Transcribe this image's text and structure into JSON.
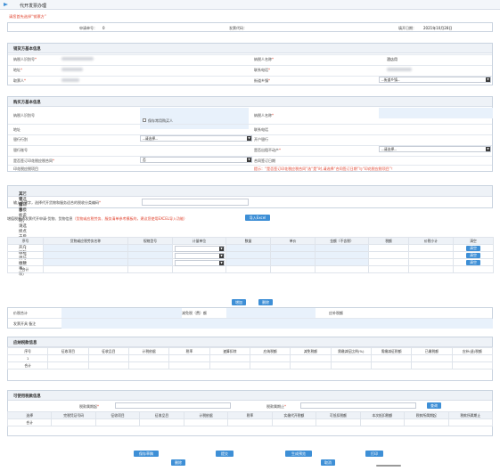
{
  "page": {
    "title": "代开发票办理",
    "hint": "请您首先选择“销票方”"
  },
  "top": {
    "apply_no_label": "申请单号：",
    "apply_no_value": "0",
    "invoice_code_label": "发票代码：",
    "fill_date_label": "填开日期：",
    "fill_date_value": "2021年10月28日"
  },
  "seller": {
    "section": "销货方基本信息",
    "taxid_label": "纳税人识别号",
    "name_label": "纳税人名称",
    "name_value": "酒店用",
    "address_label": "地址",
    "phone_label": "联系电话",
    "ticket_party_label": "取票人",
    "township_label": "街道乡镇",
    "township_value": "--街道乡镇--"
  },
  "buyer": {
    "section": "购买方基本信息",
    "taxid_label": "纳税人识别号",
    "name_label": "纳税人名称",
    "save_common_label": "保存常用购买人",
    "address_label": "地址",
    "phone_label": "联系电话",
    "bank_label": "银行行别",
    "bank_value": "--请选择--",
    "branch_label": "开户银行",
    "account_label": "银行账号",
    "flag_label": "是否出租不动产",
    "flag_value": "--请选择--",
    "sign_label": "是否签订印花税应税合同",
    "sign_value": "否",
    "contract_date_label": "合同签订日期",
    "stamp_item_label": "印花税应税项目",
    "stamp_hint": "提示：“是否签订印花税应税合同”选“是”时,请选择“合同签订日期”与“印花税应税项目”！"
  },
  "quick": {
    "section_label": "其它信息",
    "section_hint": "（若请选择辅导模板说明，请选择点击后选择开户缴税调与缴税事项）",
    "keyword_label": "输入关键字，选择代开货物和服务适合的税收分类编码",
    "import_hint_prefix": "增值税普通发票代开申请-货物、货物信息",
    "import_hint_red": "（货物或应税劳务、服务清单参考模板的，建议您使用EXCEL导入功能）",
    "import_button": "导入Excel"
  },
  "goods_table": {
    "headers": [
      "序号",
      "货物或应税劳务名称",
      "规格型号",
      "计量单位",
      "数量",
      "单价",
      "金额（不含税）",
      "税额",
      "价税小计",
      "清空"
    ],
    "rows": [
      {
        "no": "1",
        "action": "清空"
      },
      {
        "no": "2",
        "action": "清空"
      },
      {
        "no": "3",
        "action": "清空"
      }
    ],
    "total_label": "合计",
    "add_button": "增加",
    "delete_button": "删除"
  },
  "summary": {
    "price_total_label": "价税合计",
    "reduction_label": "减免税（费）额",
    "payable_label": "应补税额",
    "remark_label": "发票开具 备注"
  },
  "tax_table": {
    "section": "应纳税款信息",
    "headers": [
      "序号",
      "征收项目",
      "征收品目",
      "计税依据",
      "税率",
      "速算扣除",
      "应纳税额",
      "减免税额",
      "需缴减征比例(%)",
      "需缴减征税额",
      "已缴税额",
      "应补(退)税额"
    ],
    "rows": [
      {
        "no": "1"
      }
    ],
    "total_label": "合计"
  },
  "deduct": {
    "section": "可使用税款信息",
    "start_label": "税款属期起",
    "end_label": "税款属期止",
    "query_button": "查询",
    "headers": [
      "选择",
      "完税凭证号码",
      "征收项目",
      "征收品目",
      "计税依据",
      "税率",
      "实缴代开税额",
      "可抵扣税额",
      "本次抵扣税额",
      "税款所属期起",
      "税款所属期止"
    ],
    "total_label": "合计"
  },
  "footer": {
    "preview": "保存草稿",
    "submit": "提交",
    "reset": "生成预览",
    "print": "打印",
    "delete": "删除",
    "cancel": "取消"
  },
  "colors": {
    "accent": "#3e8fd6",
    "warning": "#e0432e",
    "header_bg": "#eef2f7"
  }
}
